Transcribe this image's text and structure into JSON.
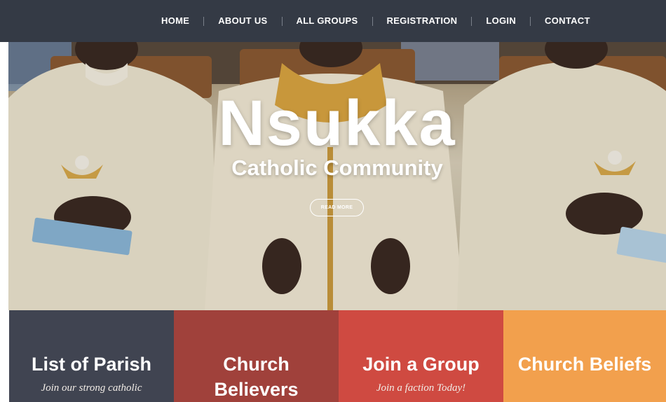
{
  "nav": {
    "items": [
      "HOME",
      "ABOUT US",
      "ALL GROUPS",
      "REGISTRATION",
      "LOGIN",
      "CONTACT"
    ]
  },
  "hero": {
    "title": "Nsukka",
    "subtitle": "Catholic Community",
    "button_label": "READ MORE"
  },
  "features": [
    {
      "title": "List of Parish",
      "description": "Join our strong catholic",
      "color": "#404451"
    },
    {
      "title": "Church Believers",
      "description": "",
      "color": "#a0413b"
    },
    {
      "title": "Join a Group",
      "description": "Join a faction Today!",
      "color": "#cf4a41"
    },
    {
      "title": "Church Beliefs",
      "description": "",
      "color": "#f2a04d"
    }
  ],
  "colors": {
    "nav_bg": "#343a45",
    "nav_text": "#ffffff"
  }
}
